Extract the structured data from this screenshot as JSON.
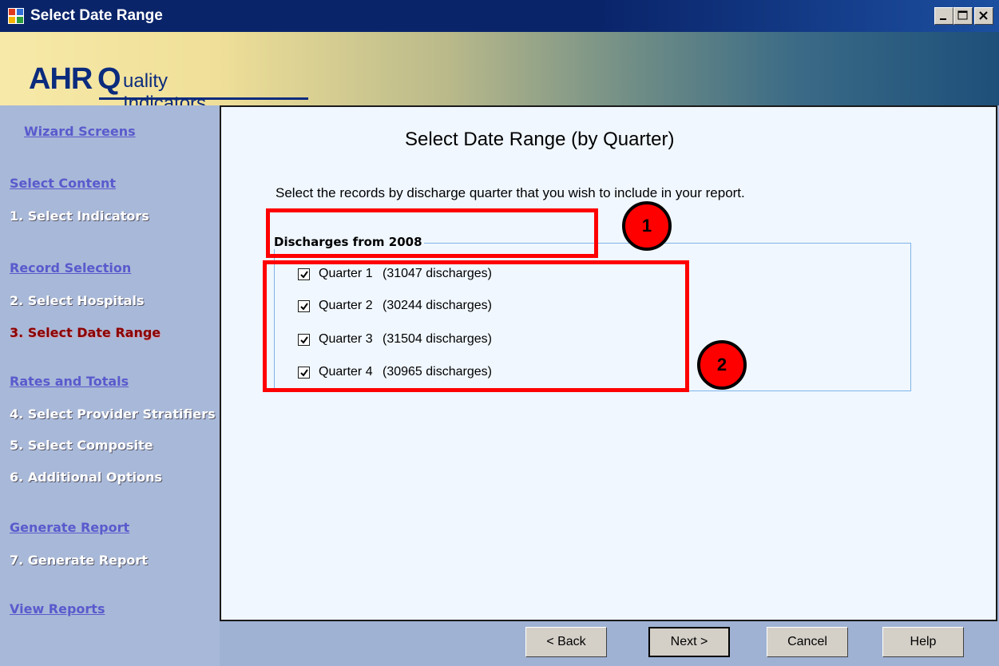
{
  "window": {
    "title": "Select Date Range"
  },
  "banner": {
    "logo_text_ahr": "AHR",
    "logo_text_q": "Q",
    "logo_text_rest": "uality Indicators"
  },
  "sidebar": {
    "header": "Wizard Screens",
    "section_select_content": "Select Content",
    "step_1": "1. Select Indicators",
    "section_record_selection": "Record Selection",
    "step_2": "2. Select Hospitals",
    "step_3": "3. Select Date Range",
    "section_rates_totals": "Rates and Totals",
    "step_4": "4. Select Provider Stratifiers",
    "step_5": "5. Select Composite",
    "step_6": "6. Additional Options",
    "section_generate_report": "Generate Report",
    "step_7": "7. Generate Report",
    "section_view_reports": "View Reports"
  },
  "main": {
    "heading": "Select Date Range (by Quarter)",
    "instruction": "Select the records by discharge quarter that you wish to include in your report.",
    "group_title": "Discharges from 2008",
    "quarters": [
      {
        "label": "Quarter 1",
        "count": "(31047 discharges)",
        "checked": true
      },
      {
        "label": "Quarter 2",
        "count": "(30244 discharges)",
        "checked": true
      },
      {
        "label": "Quarter 3",
        "count": "(31504 discharges)",
        "checked": true
      },
      {
        "label": "Quarter 4",
        "count": "(30965 discharges)",
        "checked": true
      }
    ]
  },
  "annotations": {
    "callout_1": "1",
    "callout_2": "2",
    "annotation_color": "#ff0000"
  },
  "buttons": {
    "back": "< Back",
    "next": "Next >",
    "cancel": "Cancel",
    "help": "Help"
  }
}
